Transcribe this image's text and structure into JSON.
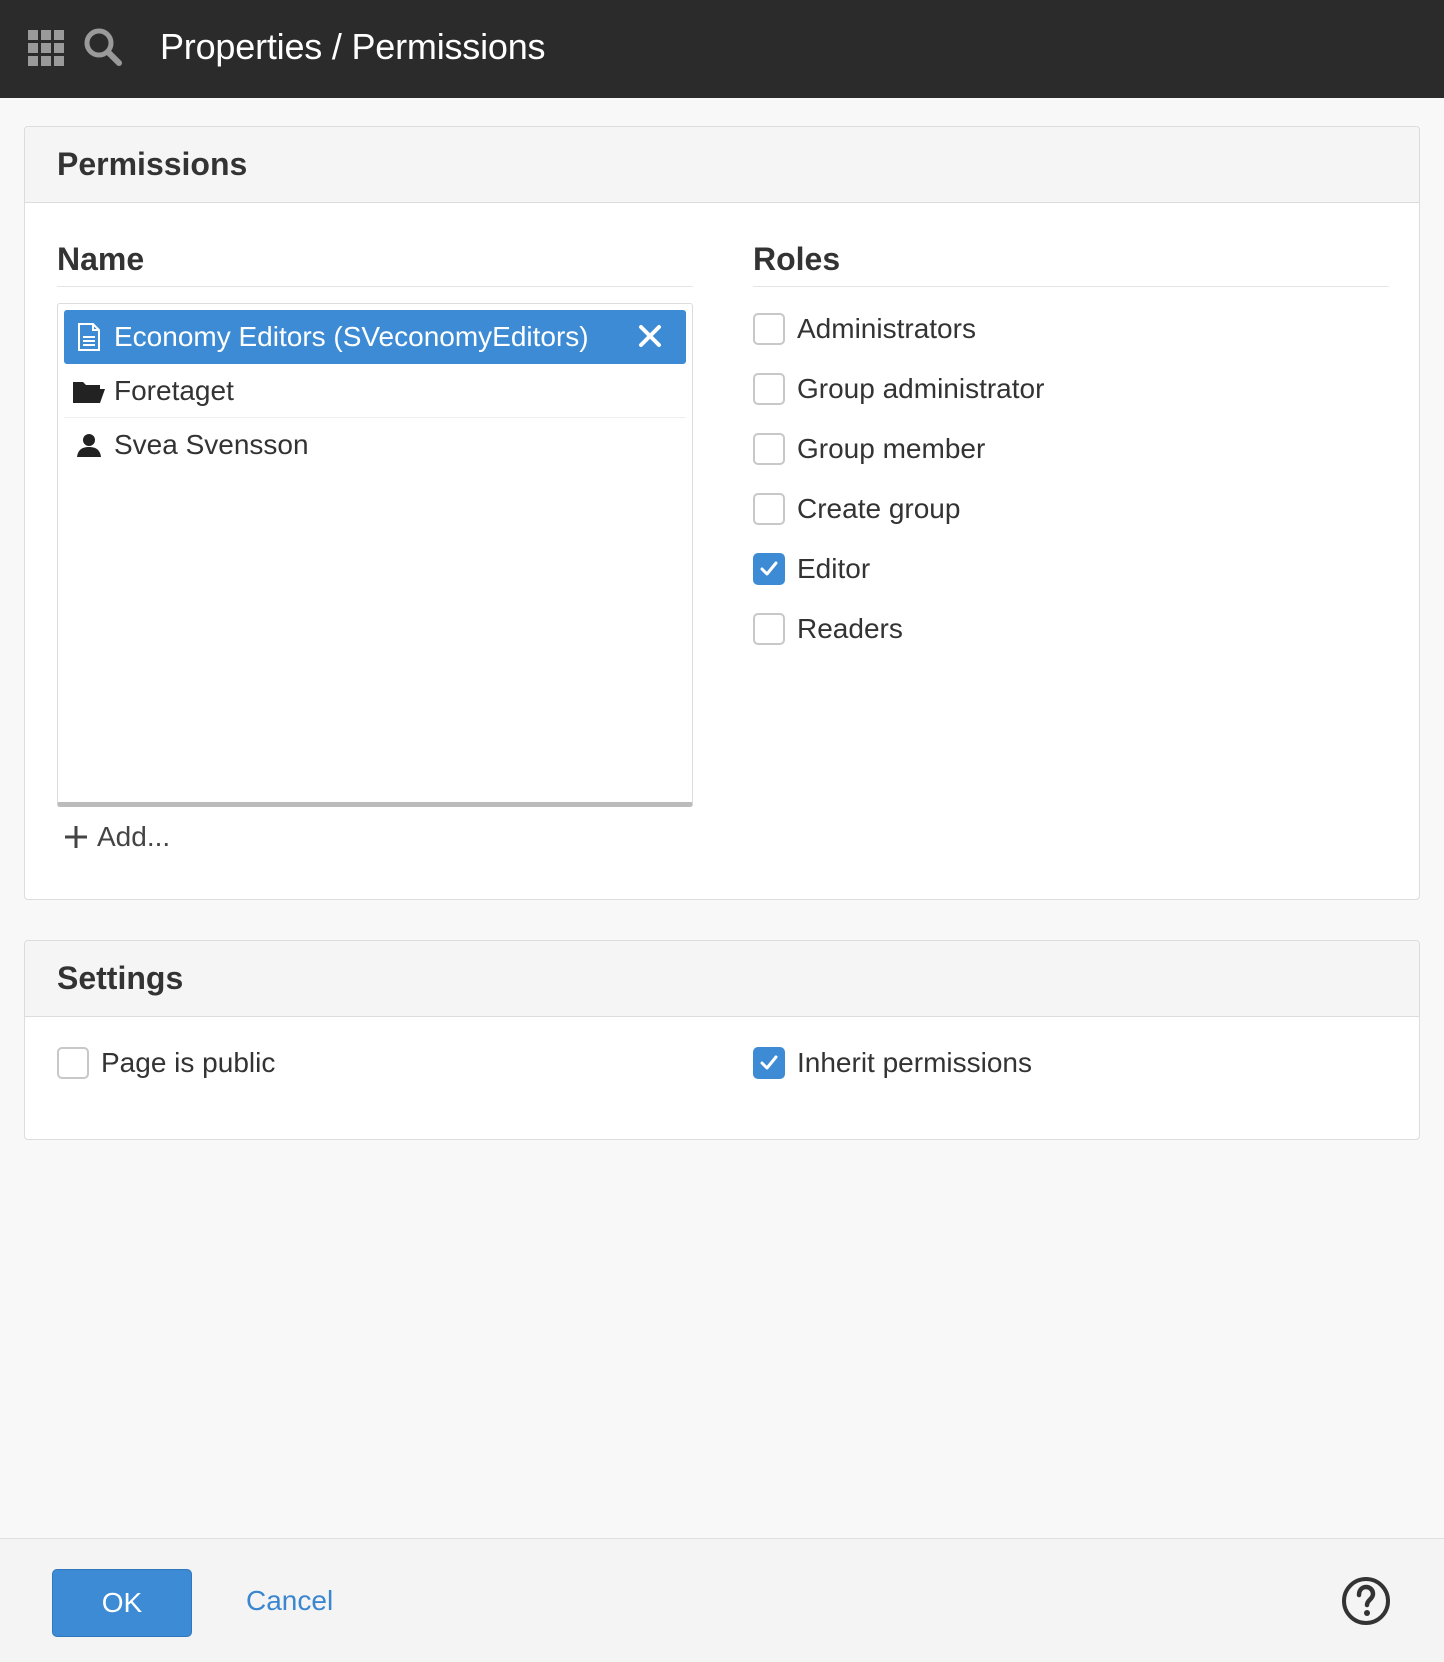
{
  "header": {
    "title": "Properties / Permissions",
    "icons": [
      "apps-grid-icon",
      "search-icon"
    ]
  },
  "permissions": {
    "title": "Permissions",
    "name_heading": "Name",
    "roles_heading": "Roles",
    "names": [
      {
        "label": "Economy Editors (SVeconomyEditors)",
        "icon": "document-icon",
        "selected": true
      },
      {
        "label": "Foretaget",
        "icon": "folder-icon",
        "selected": false
      },
      {
        "label": "Svea Svensson",
        "icon": "user-icon",
        "selected": false
      }
    ],
    "add_label": "Add...",
    "roles": [
      {
        "label": "Administrators",
        "checked": false
      },
      {
        "label": "Group administrator",
        "checked": false
      },
      {
        "label": "Group member",
        "checked": false
      },
      {
        "label": "Create group",
        "checked": false
      },
      {
        "label": "Editor",
        "checked": true
      },
      {
        "label": "Readers",
        "checked": false
      }
    ]
  },
  "settings": {
    "title": "Settings",
    "page_public": {
      "label": "Page is public",
      "checked": false
    },
    "inherit_permissions": {
      "label": "Inherit permissions",
      "checked": true
    }
  },
  "footer": {
    "ok_label": "OK",
    "cancel_label": "Cancel",
    "help_icon": "help-icon"
  },
  "colors": {
    "topbar": "#2b2b2b",
    "accent": "#3d8bd4",
    "link": "#3a87cf"
  }
}
